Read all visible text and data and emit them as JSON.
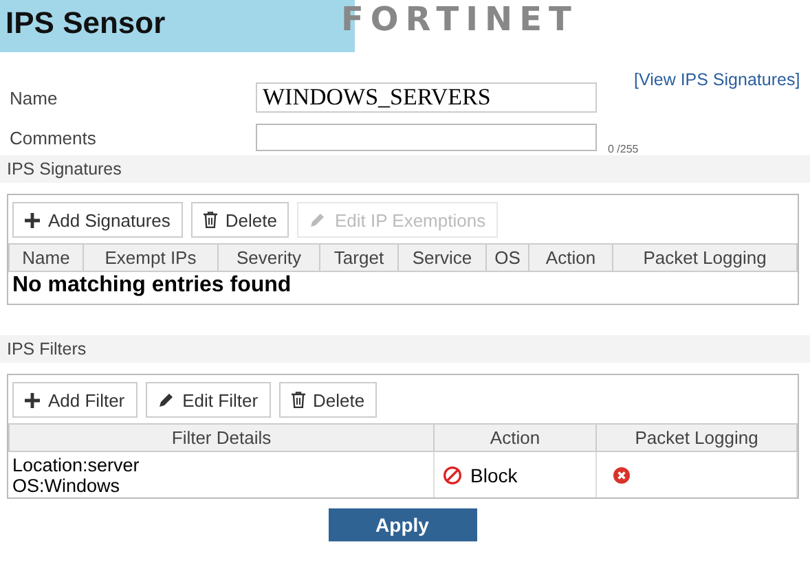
{
  "header": {
    "title": "IPS Sensor",
    "logo": "FORTINET"
  },
  "form": {
    "name_label": "Name",
    "name_value": "WINDOWS_SERVERS",
    "view_link": "[View IPS Signatures]",
    "comments_label": "Comments",
    "comments_count": "0 /255"
  },
  "signatures": {
    "heading": "IPS Signatures",
    "toolbar": [
      {
        "label": "Add Signatures",
        "kind": "add",
        "disabled": false
      },
      {
        "label": "Delete",
        "kind": "delete",
        "disabled": false
      },
      {
        "label": "Edit IP Exemptions",
        "kind": "edit",
        "disabled": true
      }
    ],
    "columns": [
      "Name",
      "Exempt IPs",
      "Severity",
      "Target",
      "Service",
      "OS",
      "Action",
      "Packet Logging"
    ],
    "empty_message": "No matching entries found"
  },
  "filters": {
    "heading": "IPS Filters",
    "toolbar": [
      {
        "label": "Add Filter",
        "kind": "add",
        "disabled": false
      },
      {
        "label": "Edit Filter",
        "kind": "edit",
        "disabled": false
      },
      {
        "label": "Delete",
        "kind": "delete",
        "disabled": false
      }
    ],
    "columns": [
      "Filter Details",
      "Action",
      "Packet Logging"
    ],
    "rows": [
      {
        "details": [
          "Location:server",
          "OS:Windows"
        ],
        "action": "Block",
        "packet_logging": false
      }
    ]
  },
  "apply_button": "Apply"
}
